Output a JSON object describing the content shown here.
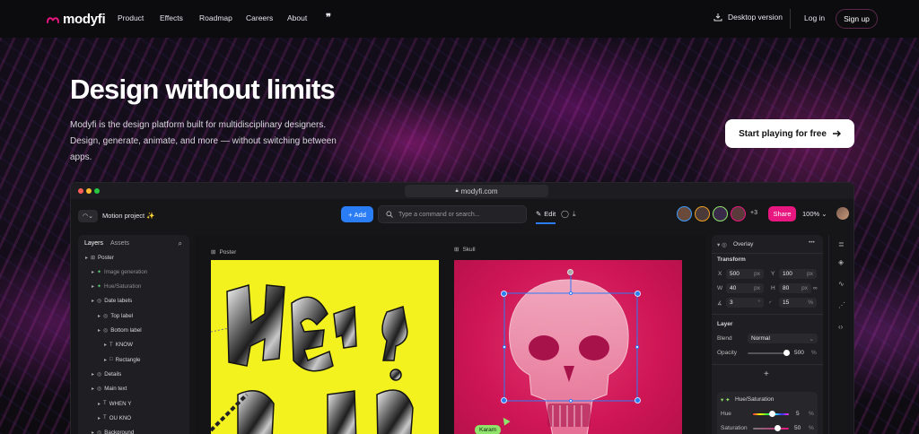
{
  "nav": {
    "brand": "modyfi",
    "links": [
      "Product",
      "Effects",
      "Roadmap",
      "Careers",
      "About"
    ],
    "desktop_label": "Desktop version",
    "login_label": "Log in",
    "signup_label": "Sign up"
  },
  "hero": {
    "title": "Design without limits",
    "subtitle": "Modyfi is the design platform built for multidisciplinary designers. Design, generate, animate, and more — without switching between apps.",
    "cta_label": "Start playing for free"
  },
  "app": {
    "url": "modyfi.com",
    "project_name": "Motion project ✨",
    "add_label": "Add",
    "command_placeholder": "Type a command or search...",
    "edit_label": "Edit",
    "more_collaborators": "+3",
    "share_label": "Share",
    "zoom": "100%",
    "layers_tabs": [
      "Layers",
      "Assets"
    ],
    "layers": [
      {
        "label": "Poster",
        "level": 0,
        "icon": "frame-icon",
        "dim": false
      },
      {
        "label": "Image generation",
        "level": 1,
        "icon": "generator-icon",
        "dim": true
      },
      {
        "label": "Hue/Saturation",
        "level": 1,
        "icon": "filter-icon",
        "dim": true
      },
      {
        "label": "Date labels",
        "level": 1,
        "icon": "group-icon",
        "dim": false
      },
      {
        "label": "Top label",
        "level": 2,
        "icon": "group-icon",
        "dim": false
      },
      {
        "label": "Bottom label",
        "level": 2,
        "icon": "group-icon",
        "dim": false
      },
      {
        "label": "KNOW",
        "level": 3,
        "icon": "text-icon",
        "dim": false
      },
      {
        "label": "Rectangle",
        "level": 3,
        "icon": "rect-icon",
        "dim": false
      },
      {
        "label": "Details",
        "level": 1,
        "icon": "group-icon",
        "dim": false
      },
      {
        "label": "Main text",
        "level": 1,
        "icon": "group-icon",
        "dim": false
      },
      {
        "label": "WHEN Y",
        "level": 2,
        "icon": "text-icon",
        "dim": false
      },
      {
        "label": "OU KNO",
        "level": 2,
        "icon": "text-icon",
        "dim": false
      },
      {
        "label": "Background",
        "level": 1,
        "icon": "group-icon",
        "dim": false
      }
    ],
    "canvas_labels": {
      "poster": "Poster",
      "skull": "Skull"
    },
    "collaborator_cursor": "Karam",
    "props": {
      "layer_name": "Overlay",
      "transform_title": "Transform",
      "x": "500",
      "y": "100",
      "w": "40",
      "h": "80",
      "angle": "3",
      "radius": "15",
      "unit": "px",
      "deg": "°",
      "pct": "%",
      "layer_title": "Layer",
      "blend_label": "Blend",
      "blend_value": "Normal",
      "opacity_label": "Opacity",
      "opacity_value": "500",
      "add_symbol": "+",
      "filter_name": "Hue/Saturation",
      "hue_label": "Hue",
      "hue_value": "5",
      "saturation_label": "Saturation",
      "saturation_value": "50"
    }
  },
  "colors": {
    "accent_pink": "#e7177f",
    "accent_blue": "#2a7df5",
    "poster_yellow": "#f3f11e",
    "skull_pink": "#d01656"
  }
}
